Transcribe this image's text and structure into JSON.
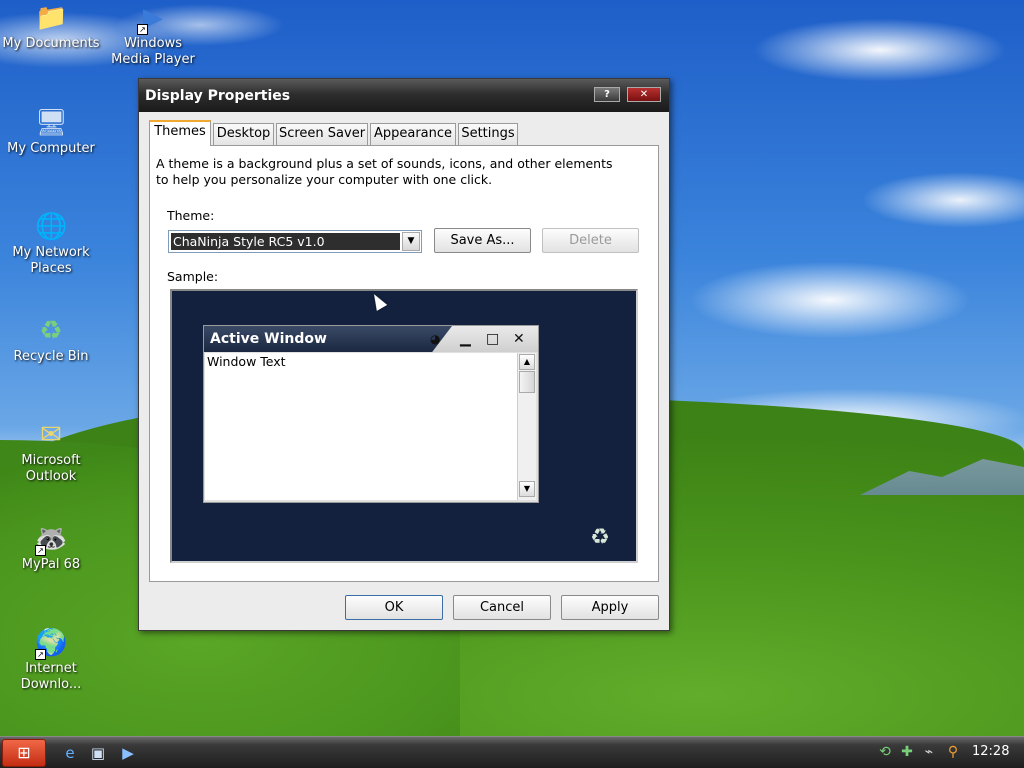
{
  "desktop": {
    "icons": [
      {
        "label": "My Documents",
        "glyph": "folder-icon"
      },
      {
        "label": "Windows Media Player",
        "glyph": "media-player-icon"
      },
      {
        "label": "My Computer",
        "glyph": "computer-icon"
      },
      {
        "label": "My Network Places",
        "glyph": "network-icon"
      },
      {
        "label": "Recycle Bin",
        "glyph": "recycle-bin-icon"
      },
      {
        "label": "Microsoft Outlook",
        "glyph": "outlook-icon"
      },
      {
        "label": "MyPal 68",
        "glyph": "mypal-icon"
      },
      {
        "label": "Internet Downlo...",
        "glyph": "download-manager-icon"
      }
    ]
  },
  "dialog": {
    "title": "Display Properties",
    "help_label": "?",
    "close_label": "✕",
    "tabs": [
      {
        "label": "Themes",
        "active": true
      },
      {
        "label": "Desktop",
        "active": false
      },
      {
        "label": "Screen Saver",
        "active": false
      },
      {
        "label": "Appearance",
        "active": false
      },
      {
        "label": "Settings",
        "active": false
      }
    ],
    "description": "A theme is a background plus a set of sounds, icons, and other elements to help you personalize your computer with one click.",
    "theme_label": "Theme:",
    "theme_value": "ChaNinja Style RC5 v1.0",
    "save_as_label": "Save As...",
    "delete_label": "Delete",
    "sample_label": "Sample:",
    "sample": {
      "window_title": "Active Window",
      "window_text": "Window Text"
    },
    "ok_label": "OK",
    "cancel_label": "Cancel",
    "apply_label": "Apply"
  },
  "taskbar": {
    "start_glyph": "windows-logo-icon",
    "clock": "12:28"
  },
  "colors": {
    "titlebar": "#1a1a1a",
    "sample_background": "#13213f",
    "start_button": "#d83a1c",
    "active_tab_accent": "#f0a830"
  }
}
